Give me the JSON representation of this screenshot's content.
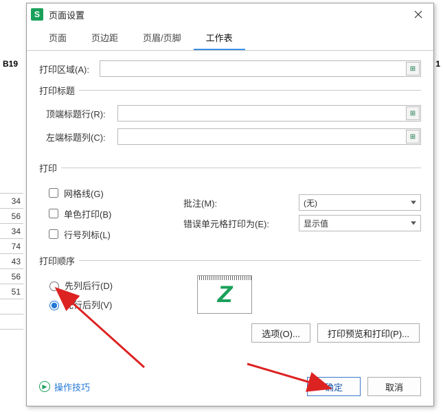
{
  "bg": {
    "cellref": "B19",
    "corner": "1",
    "rownums": [
      "",
      "34",
      "56",
      "34",
      "74",
      "43",
      "56",
      "51",
      "",
      ""
    ]
  },
  "dialog": {
    "app_icon_letter": "S",
    "title": "页面设置"
  },
  "tabs": {
    "page": "页面",
    "margins": "页边距",
    "headerfooter": "页眉/页脚",
    "sheet": "工作表"
  },
  "fields": {
    "print_area_label": "打印区域(A):",
    "print_area_value": "",
    "print_title_legend": "打印标题",
    "rows_repeat_label": "顶端标题行(R):",
    "rows_repeat_value": "",
    "cols_repeat_label": "左端标题列(C):",
    "cols_repeat_value": ""
  },
  "print_group": {
    "legend": "打印",
    "gridlines": "网格线(G)",
    "bw": "单色打印(B)",
    "rowcolhdr": "行号列标(L)",
    "comments_label": "批注(M):",
    "comments_value": "(无)",
    "errors_label": "错误单元格打印为(E):",
    "errors_value": "显示值"
  },
  "order_group": {
    "legend": "打印顺序",
    "down_then_over": "先列后行(D)",
    "over_then_down": "先行后列(V)"
  },
  "buttons": {
    "options": "选项(O)...",
    "preview": "打印预览和打印(P)...",
    "ok": "确定",
    "cancel": "取消"
  },
  "footer": {
    "tips": "操作技巧"
  }
}
